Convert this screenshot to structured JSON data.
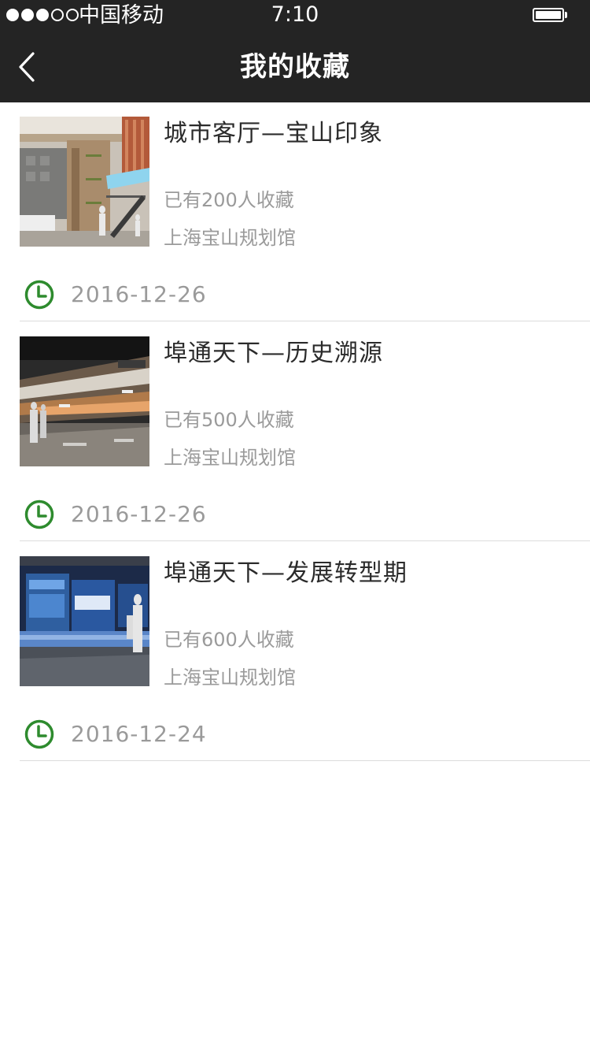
{
  "status_bar": {
    "carrier": "中国移动",
    "time": "7:10",
    "signal_strength": 3,
    "signal_max": 5
  },
  "nav": {
    "back_icon": "chevron-left-icon",
    "title": "我的收藏"
  },
  "colors": {
    "bar_background": "#242424",
    "accent_green": "#2e8b2e",
    "title_text": "#2b2b2b",
    "meta_text": "#9a9a9a",
    "divider": "#dcdcdc"
  },
  "favorites": [
    {
      "title": "城市客厅—宝山印象",
      "count_text": "已有200人收藏",
      "venue": "上海宝山规划馆",
      "date": "2016-12-26",
      "thumbnail": "exhibition-lobby-photo"
    },
    {
      "title": "埠通天下—历史溯源",
      "count_text": "已有500人收藏",
      "venue": "上海宝山规划馆",
      "date": "2016-12-26",
      "thumbnail": "history-gallery-photo"
    },
    {
      "title": "埠通天下—发展转型期",
      "count_text": "已有600人收藏",
      "venue": "上海宝山规划馆",
      "date": "2016-12-24",
      "thumbnail": "digital-display-wall-photo"
    }
  ]
}
